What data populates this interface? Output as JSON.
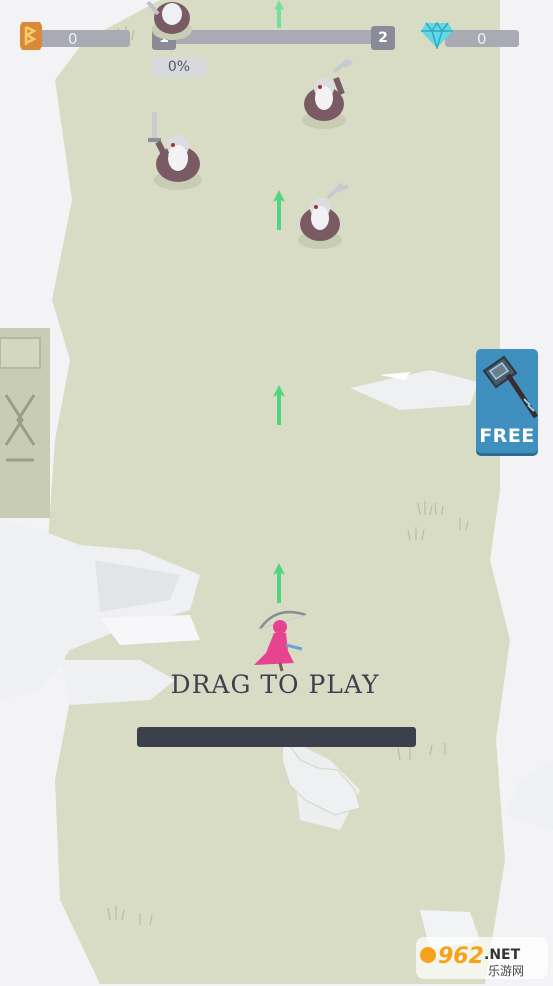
{
  "hud": {
    "runes_count": "0",
    "gems_count": "0",
    "level_current": "1",
    "level_next": "2",
    "progress_label": "0%",
    "progress": 0.0
  },
  "offer": {
    "label": "FREE",
    "icon": "hammer-icon"
  },
  "prompt": {
    "label": "DRAG TO PLAY"
  },
  "watermark": {
    "text": "962.NET",
    "subtext": "乐游网"
  },
  "colors": {
    "ground": "#d9dcc4",
    "snow": "#f3f3f5",
    "enemy": "#7a5b64",
    "player": "#e8438f",
    "arrow": "#62e08d",
    "offer_bg": "#3f8fbf"
  }
}
